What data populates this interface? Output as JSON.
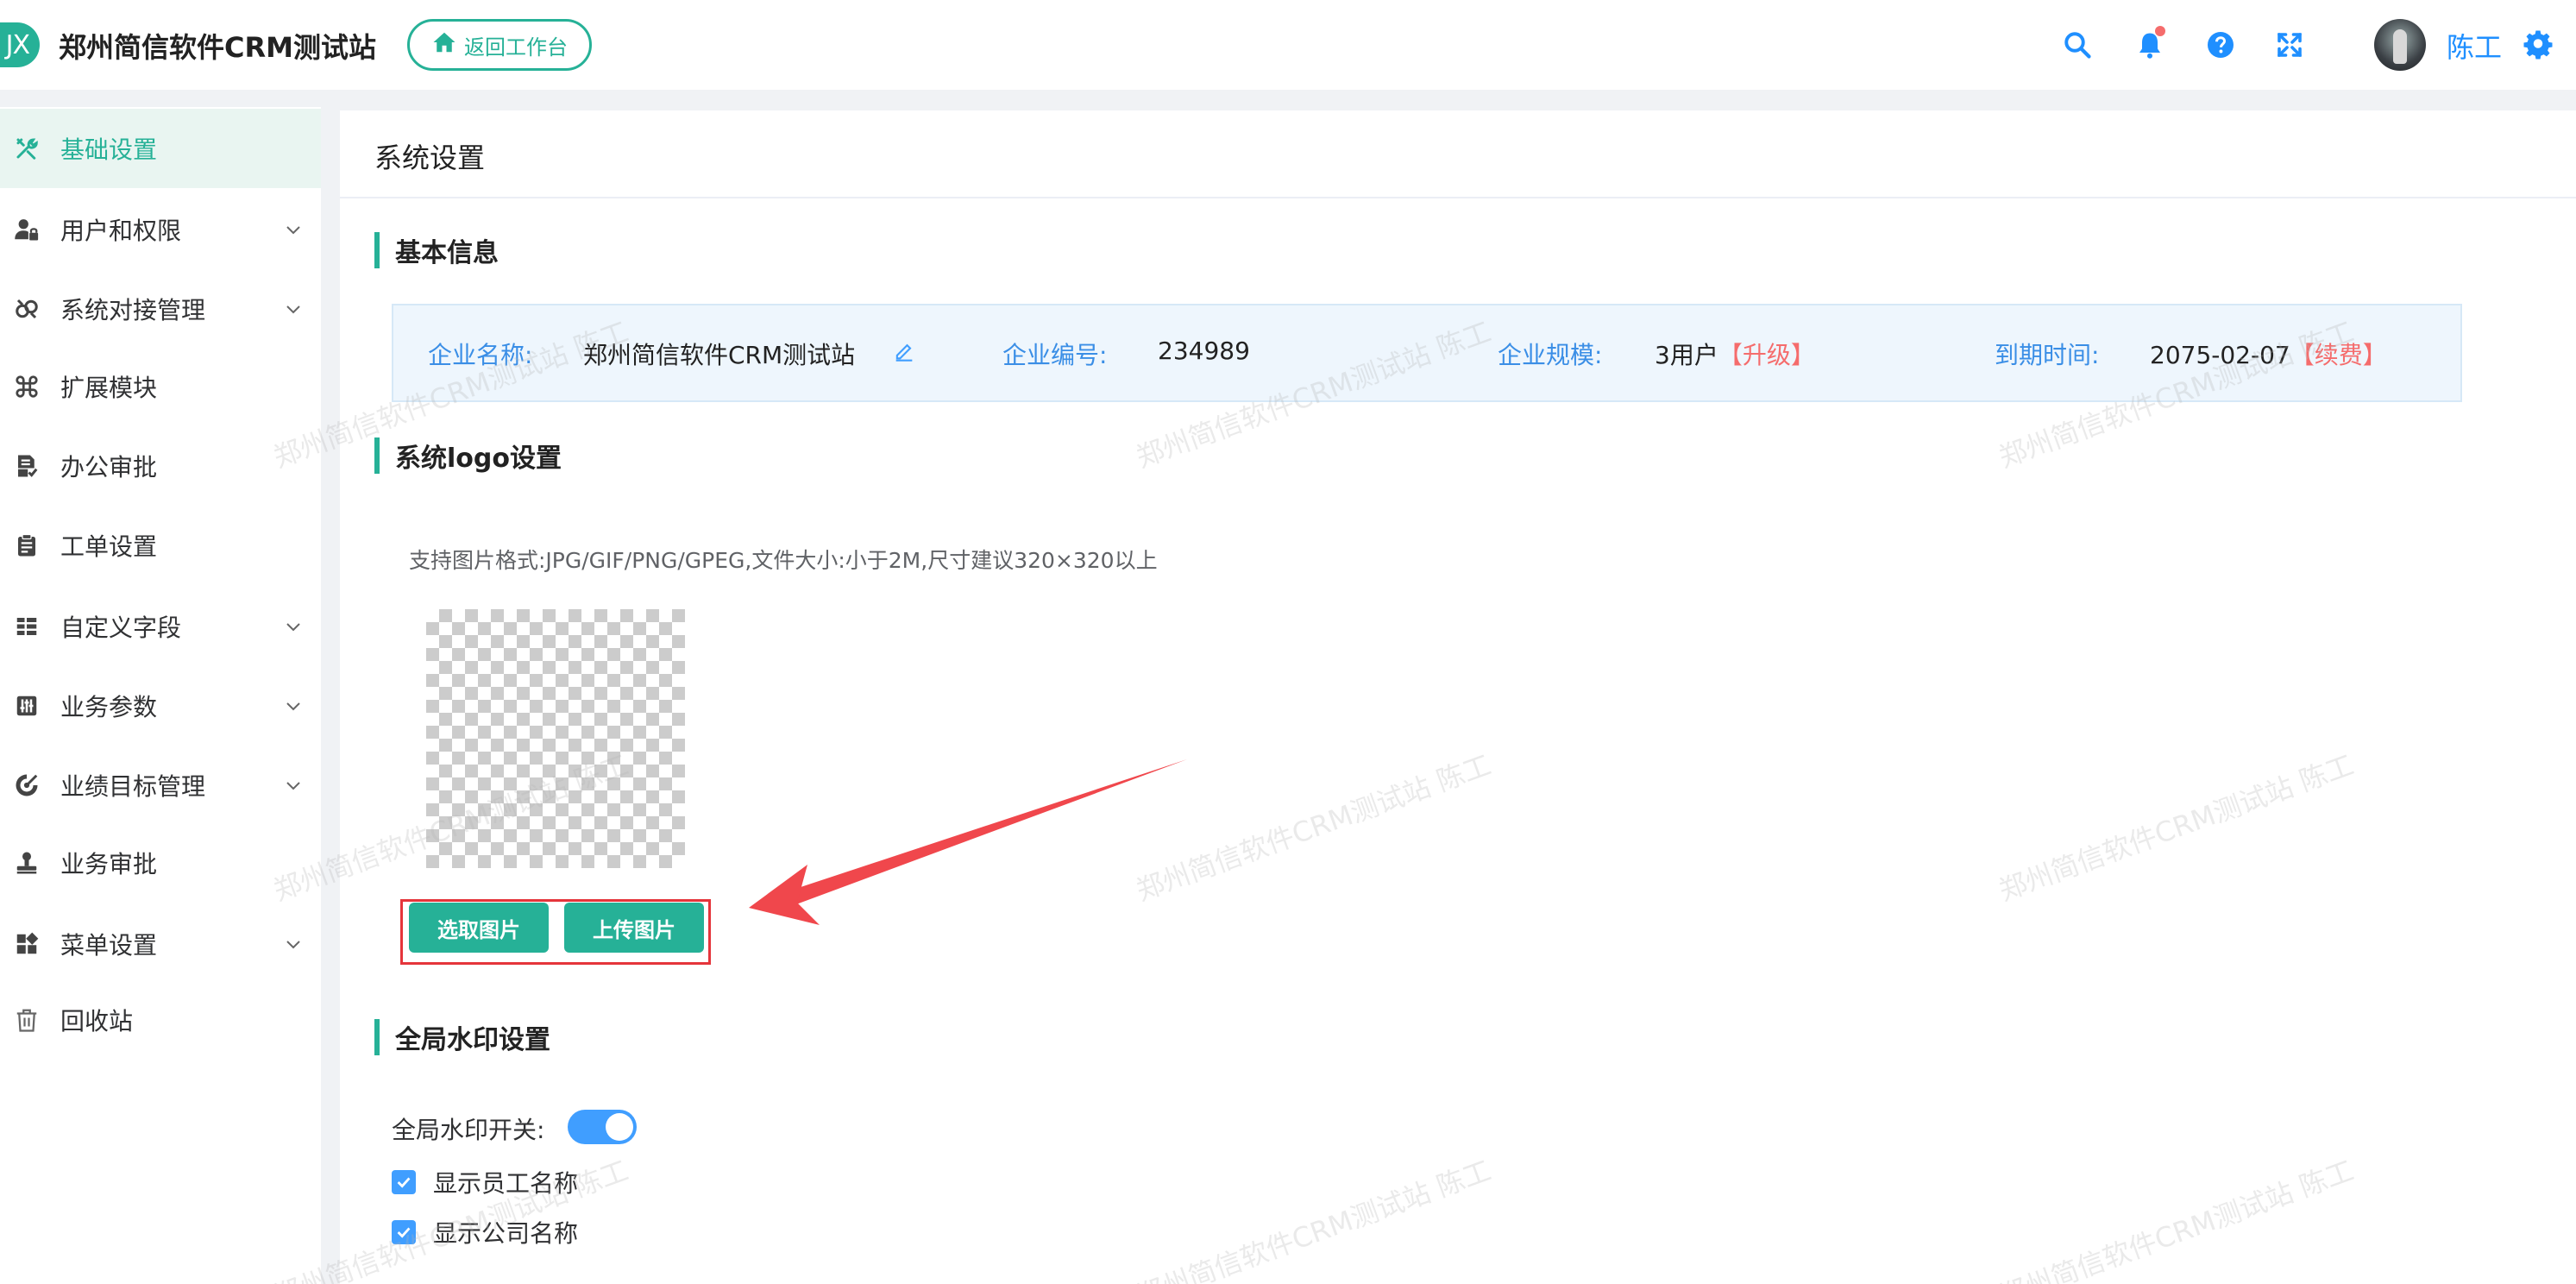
{
  "header": {
    "logo_text": "JX",
    "app_title": "郑州简信软件CRM测试站",
    "back_button": "返回工作台",
    "user_name": "陈工"
  },
  "sidebar": {
    "items": [
      {
        "label": "基础设置",
        "icon": "tools-icon",
        "active": true,
        "has_children": false
      },
      {
        "label": "用户和权限",
        "icon": "user-lock-icon",
        "active": false,
        "has_children": true
      },
      {
        "label": "系统对接管理",
        "icon": "link-icon",
        "active": false,
        "has_children": true
      },
      {
        "label": "扩展模块",
        "icon": "command-icon",
        "active": false,
        "has_children": false
      },
      {
        "label": "办公审批",
        "icon": "document-check-icon",
        "active": false,
        "has_children": false
      },
      {
        "label": "工单设置",
        "icon": "clipboard-icon",
        "active": false,
        "has_children": false
      },
      {
        "label": "自定义字段",
        "icon": "list-icon",
        "active": false,
        "has_children": true
      },
      {
        "label": "业务参数",
        "icon": "sliders-icon",
        "active": false,
        "has_children": true
      },
      {
        "label": "业绩目标管理",
        "icon": "target-icon",
        "active": false,
        "has_children": true
      },
      {
        "label": "业务审批",
        "icon": "stamp-icon",
        "active": false,
        "has_children": false
      },
      {
        "label": "菜单设置",
        "icon": "grid-icon",
        "active": false,
        "has_children": true
      },
      {
        "label": "回收站",
        "icon": "trash-icon",
        "active": false,
        "has_children": false
      }
    ]
  },
  "main": {
    "page_title": "系统设置",
    "basic_info": {
      "section_title": "基本信息",
      "company_name_label": "企业名称:",
      "company_name": "郑州简信软件CRM测试站",
      "company_id_label": "企业编号:",
      "company_id": "234989",
      "scale_label": "企业规模:",
      "scale_value": "3用户",
      "upgrade": "【升级】",
      "expire_label": "到期时间:",
      "expire_value": "2075-02-07",
      "renew": "【续费】"
    },
    "logo": {
      "section_title": "系统logo设置",
      "hint": "支持图片格式:JPG/GIF/PNG/GPEG,文件大小:小于2M,尺寸建议320×320以上",
      "select_button": "选取图片",
      "upload_button": "上传图片"
    },
    "watermark": {
      "section_title": "全局水印设置",
      "switch_label": "全局水印开关:",
      "switch_on": true,
      "show_employee_label": "显示员工名称",
      "show_employee_checked": true,
      "show_company_label": "显示公司名称",
      "show_company_checked": true
    }
  },
  "watermark_text": "郑州简信软件CRM测试站 陈工",
  "colors": {
    "brand": "#26b197",
    "link_blue": "#1f8fff",
    "warning_red": "#f56c6c",
    "annotation_red": "#e5353b"
  }
}
